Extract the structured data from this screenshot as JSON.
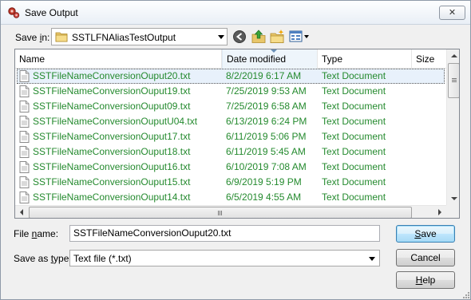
{
  "window": {
    "title": "Save Output",
    "close_label": "✕"
  },
  "save_in": {
    "label_pre": "Save ",
    "label_key": "i",
    "label_post": "n:",
    "value": "SSTLFNAliasTestOutput"
  },
  "columns": {
    "name": "Name",
    "date": "Date modified",
    "type": "Type",
    "size": "Size"
  },
  "files": [
    {
      "name": "SSTFileNameConversionOuput20.txt",
      "date": "8/2/2019 6:17 AM",
      "type": "Text Document"
    },
    {
      "name": "SSTFileNameConversionOuput19.txt",
      "date": "7/25/2019 9:53 AM",
      "type": "Text Document"
    },
    {
      "name": "SSTFileNameConversionOuput09.txt",
      "date": "7/25/2019 6:58 AM",
      "type": "Text Document"
    },
    {
      "name": "SSTFileNameConversionOuputU04.txt",
      "date": "6/13/2019 6:24 PM",
      "type": "Text Document"
    },
    {
      "name": "SSTFileNameConversionOuput17.txt",
      "date": "6/11/2019 5:06 PM",
      "type": "Text Document"
    },
    {
      "name": "SSTFileNameConversionOuput18.txt",
      "date": "6/11/2019 5:45 AM",
      "type": "Text Document"
    },
    {
      "name": "SSTFileNameConversionOuput16.txt",
      "date": "6/10/2019 7:08 AM",
      "type": "Text Document"
    },
    {
      "name": "SSTFileNameConversionOuput15.txt",
      "date": "6/9/2019 5:19 PM",
      "type": "Text Document"
    },
    {
      "name": "SSTFileNameConversionOuput14.txt",
      "date": "6/5/2019 4:55 AM",
      "type": "Text Document"
    }
  ],
  "file_name": {
    "label_pre": "File ",
    "label_key": "n",
    "label_post": "ame:",
    "value": "SSTFileNameConversionOuput20.txt"
  },
  "save_as_type": {
    "label_pre": "Save as ",
    "label_key": "t",
    "label_post": "ype:",
    "value": "Text file  (*.txt)"
  },
  "buttons": {
    "save_key": "S",
    "save_rest": "ave",
    "cancel": "Cancel",
    "help_key": "H",
    "help_rest": "elp"
  },
  "colors": {
    "file_text": "#248a2e",
    "selection": "#e8f1fb",
    "title_bg": "#e9eff6"
  },
  "icons": [
    "app-gear-icon",
    "folder-icon",
    "back-icon",
    "up-folder-icon",
    "new-folder-icon",
    "views-menu-icon",
    "text-file-icon"
  ]
}
